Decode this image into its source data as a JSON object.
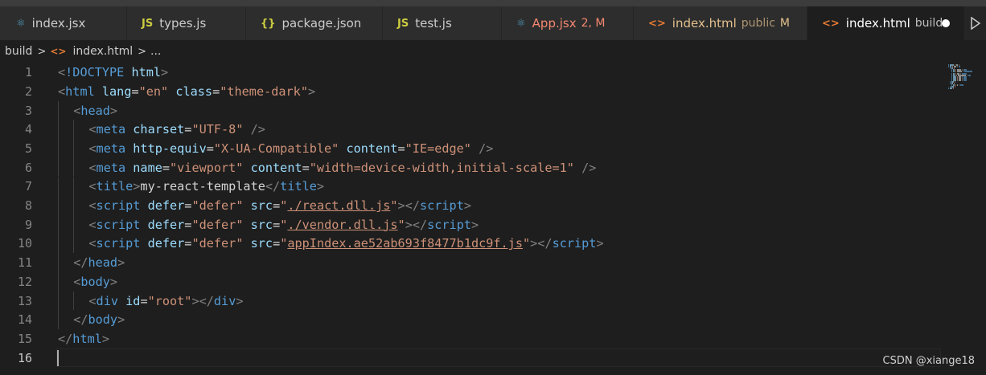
{
  "tabs": [
    {
      "icon": "react-icon",
      "glyph": "⚛",
      "name": "index.jsx",
      "sub": "",
      "badge": "",
      "color": "#cccccc",
      "icon_color": "#519aba",
      "width": 158
    },
    {
      "icon": "js-icon",
      "glyph": "JS",
      "name": "types.js",
      "sub": "",
      "badge": "",
      "color": "#cccccc",
      "icon_color": "#cbcb41",
      "width": 148
    },
    {
      "icon": "json-icon",
      "glyph": "{}",
      "name": "package.json",
      "sub": "",
      "badge": "",
      "color": "#cccccc",
      "icon_color": "#cbcb41",
      "width": 170
    },
    {
      "icon": "js-icon",
      "glyph": "JS",
      "name": "test.js",
      "sub": "",
      "badge": "",
      "color": "#cccccc",
      "icon_color": "#cbcb41",
      "width": 148
    },
    {
      "icon": "react-icon",
      "glyph": "⚛",
      "name": "App.jsx",
      "sub": "",
      "badge": "2, M",
      "color": "#f48771",
      "icon_color": "#519aba",
      "width": 164
    },
    {
      "icon": "html-icon",
      "glyph": "<>",
      "name": "index.html",
      "sub": "public",
      "badge": "M",
      "color": "#e2c08d",
      "icon_color": "#e37933",
      "width": 216
    },
    {
      "icon": "html-icon",
      "glyph": "<>",
      "name": "index.html",
      "sub": "build",
      "badge": "",
      "color": "#ffffff",
      "icon_color": "#e37933",
      "width": 196,
      "active": true,
      "dirty": true
    }
  ],
  "breadcrumb": {
    "folder": "build",
    "file": "index.html",
    "more": "..."
  },
  "lines": [
    {
      "n": "1",
      "indent": 0,
      "tokens": [
        [
          "punct",
          "<"
        ],
        [
          "tag",
          "!DOCTYPE"
        ],
        [
          "txt",
          " "
        ],
        [
          "attr",
          "html"
        ],
        [
          "punct",
          ">"
        ]
      ]
    },
    {
      "n": "2",
      "indent": 0,
      "tokens": [
        [
          "punct",
          "<"
        ],
        [
          "tag",
          "html"
        ],
        [
          "txt",
          " "
        ],
        [
          "attr",
          "lang"
        ],
        [
          "txt",
          "="
        ],
        [
          "str",
          "\"en\""
        ],
        [
          "txt",
          " "
        ],
        [
          "attr",
          "class"
        ],
        [
          "txt",
          "="
        ],
        [
          "str",
          "\"theme-dark\""
        ],
        [
          "punct",
          ">"
        ]
      ]
    },
    {
      "n": "3",
      "indent": 1,
      "tokens": [
        [
          "punct",
          "<"
        ],
        [
          "tag",
          "head"
        ],
        [
          "punct",
          ">"
        ]
      ]
    },
    {
      "n": "4",
      "indent": 2,
      "tokens": [
        [
          "punct",
          "<"
        ],
        [
          "tag",
          "meta"
        ],
        [
          "txt",
          " "
        ],
        [
          "attr",
          "charset"
        ],
        [
          "txt",
          "="
        ],
        [
          "str",
          "\"UTF-8\""
        ],
        [
          "txt",
          " "
        ],
        [
          "punct",
          "/>"
        ]
      ]
    },
    {
      "n": "5",
      "indent": 2,
      "tokens": [
        [
          "punct",
          "<"
        ],
        [
          "tag",
          "meta"
        ],
        [
          "txt",
          " "
        ],
        [
          "attr",
          "http-equiv"
        ],
        [
          "txt",
          "="
        ],
        [
          "str",
          "\"X-UA-Compatible\""
        ],
        [
          "txt",
          " "
        ],
        [
          "attr",
          "content"
        ],
        [
          "txt",
          "="
        ],
        [
          "str",
          "\"IE=edge\""
        ],
        [
          "txt",
          " "
        ],
        [
          "punct",
          "/>"
        ]
      ]
    },
    {
      "n": "6",
      "indent": 2,
      "tokens": [
        [
          "punct",
          "<"
        ],
        [
          "tag",
          "meta"
        ],
        [
          "txt",
          " "
        ],
        [
          "attr",
          "name"
        ],
        [
          "txt",
          "="
        ],
        [
          "str",
          "\"viewport\""
        ],
        [
          "txt",
          " "
        ],
        [
          "attr",
          "content"
        ],
        [
          "txt",
          "="
        ],
        [
          "str",
          "\"width=device-width,initial-scale=1\""
        ],
        [
          "txt",
          " "
        ],
        [
          "punct",
          "/>"
        ]
      ]
    },
    {
      "n": "7",
      "indent": 2,
      "tokens": [
        [
          "punct",
          "<"
        ],
        [
          "tag",
          "title"
        ],
        [
          "punct",
          ">"
        ],
        [
          "txt",
          "my-react-template"
        ],
        [
          "punct",
          "</"
        ],
        [
          "tag",
          "title"
        ],
        [
          "punct",
          ">"
        ]
      ]
    },
    {
      "n": "8",
      "indent": 2,
      "tokens": [
        [
          "punct",
          "<"
        ],
        [
          "tag",
          "script"
        ],
        [
          "txt",
          " "
        ],
        [
          "attr",
          "defer"
        ],
        [
          "txt",
          "="
        ],
        [
          "str",
          "\"defer\""
        ],
        [
          "txt",
          " "
        ],
        [
          "attr",
          "src"
        ],
        [
          "txt",
          "="
        ],
        [
          "str",
          "\""
        ],
        [
          "link",
          "./react.dll.js"
        ],
        [
          "str",
          "\""
        ],
        [
          "punct",
          "></"
        ],
        [
          "tag",
          "script"
        ],
        [
          "punct",
          ">"
        ]
      ]
    },
    {
      "n": "9",
      "indent": 2,
      "tokens": [
        [
          "punct",
          "<"
        ],
        [
          "tag",
          "script"
        ],
        [
          "txt",
          " "
        ],
        [
          "attr",
          "defer"
        ],
        [
          "txt",
          "="
        ],
        [
          "str",
          "\"defer\""
        ],
        [
          "txt",
          " "
        ],
        [
          "attr",
          "src"
        ],
        [
          "txt",
          "="
        ],
        [
          "str",
          "\""
        ],
        [
          "link",
          "./vendor.dll.js"
        ],
        [
          "str",
          "\""
        ],
        [
          "punct",
          "></"
        ],
        [
          "tag",
          "script"
        ],
        [
          "punct",
          ">"
        ]
      ]
    },
    {
      "n": "10",
      "indent": 2,
      "tokens": [
        [
          "punct",
          "<"
        ],
        [
          "tag",
          "script"
        ],
        [
          "txt",
          " "
        ],
        [
          "attr",
          "defer"
        ],
        [
          "txt",
          "="
        ],
        [
          "str",
          "\"defer\""
        ],
        [
          "txt",
          " "
        ],
        [
          "attr",
          "src"
        ],
        [
          "txt",
          "="
        ],
        [
          "str",
          "\""
        ],
        [
          "link",
          "appIndex.ae52ab693f8477b1dc9f.js"
        ],
        [
          "str",
          "\""
        ],
        [
          "punct",
          "></"
        ],
        [
          "tag",
          "script"
        ],
        [
          "punct",
          ">"
        ]
      ]
    },
    {
      "n": "11",
      "indent": 1,
      "tokens": [
        [
          "punct",
          "</"
        ],
        [
          "tag",
          "head"
        ],
        [
          "punct",
          ">"
        ]
      ]
    },
    {
      "n": "12",
      "indent": 1,
      "tokens": [
        [
          "punct",
          "<"
        ],
        [
          "tag",
          "body"
        ],
        [
          "punct",
          ">"
        ]
      ]
    },
    {
      "n": "13",
      "indent": 2,
      "tokens": [
        [
          "punct",
          "<"
        ],
        [
          "tag",
          "div"
        ],
        [
          "txt",
          " "
        ],
        [
          "attr",
          "id"
        ],
        [
          "txt",
          "="
        ],
        [
          "str",
          "\"root\""
        ],
        [
          "punct",
          "></"
        ],
        [
          "tag",
          "div"
        ],
        [
          "punct",
          ">"
        ]
      ]
    },
    {
      "n": "14",
      "indent": 1,
      "tokens": [
        [
          "punct",
          "</"
        ],
        [
          "tag",
          "body"
        ],
        [
          "punct",
          ">"
        ]
      ]
    },
    {
      "n": "15",
      "indent": 0,
      "tokens": [
        [
          "punct",
          "</"
        ],
        [
          "tag",
          "html"
        ],
        [
          "punct",
          ">"
        ]
      ]
    },
    {
      "n": "16",
      "indent": 0,
      "tokens": [],
      "current": true
    }
  ],
  "watermark": "CSDN @xiange18",
  "colors": {
    "editor_bg": "#1e1e1e",
    "tag": "#569cd6",
    "attr": "#9cdcfe",
    "string": "#ce9178",
    "punct": "#808080"
  }
}
